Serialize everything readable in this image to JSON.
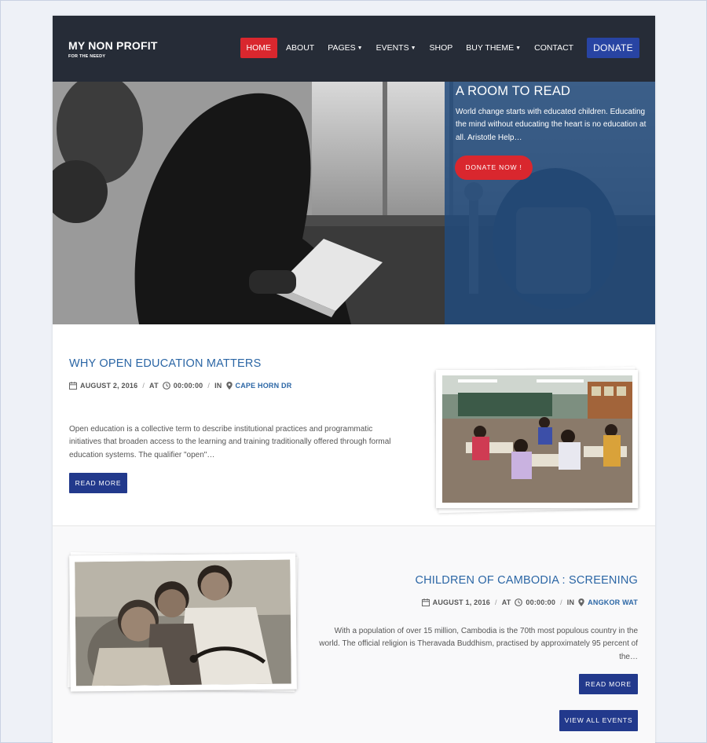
{
  "header": {
    "brand_title": "MY NON PROFIT",
    "brand_tagline": "FOR THE NEEDY",
    "nav": [
      {
        "label": "HOME",
        "active": true,
        "dropdown": false
      },
      {
        "label": "ABOUT",
        "active": false,
        "dropdown": false
      },
      {
        "label": "PAGES",
        "active": false,
        "dropdown": true
      },
      {
        "label": "EVENTS",
        "active": false,
        "dropdown": true
      },
      {
        "label": "SHOP",
        "active": false,
        "dropdown": false
      },
      {
        "label": "BUY THEME",
        "active": false,
        "dropdown": true
      },
      {
        "label": "CONTACT",
        "active": false,
        "dropdown": false
      }
    ],
    "donate_label": "DONATE"
  },
  "hero": {
    "title": "A ROOM TO READ",
    "text": "World change starts with educated children. Educating the mind without educating the heart is no education at all. Aristotle Help…",
    "button_label": "DONATE NOW !"
  },
  "posts": [
    {
      "title": "WHY OPEN EDUCATION MATTERS",
      "date": "AUGUST 2, 2016",
      "at_label": "AT",
      "time": "00:00:00",
      "in_label": "IN",
      "location": "CAPE HORN DR",
      "excerpt": "Open education is a collective term to describe institutional practices and programmatic initiatives that broaden access to the learning and training traditionally offered through formal education systems. The qualifier \"open\"…",
      "button_label": "READ MORE"
    },
    {
      "title": "CHILDREN OF CAMBODIA : SCREENING",
      "date": "AUGUST 1, 2016",
      "at_label": "AT",
      "time": "00:00:00",
      "in_label": "IN",
      "location": "ANGKOR WAT",
      "excerpt": "With a population of over 15 million, Cambodia is the 70th most populous country in the world. The official religion is Theravada Buddhism, practised by approximately 95 percent of the…",
      "button_label": "READ MORE"
    }
  ],
  "view_all_label": "VIEW ALL EVENTS",
  "colors": {
    "header_bg": "#262c37",
    "accent_red": "#d9272e",
    "accent_blue": "#22398c",
    "link_blue": "#2b66a5",
    "hero_overlay": "#224a7c"
  },
  "icons": {
    "date": "calendar-icon",
    "time": "clock-icon",
    "location": "map-marker-icon",
    "dropdown": "caret-down-icon"
  }
}
